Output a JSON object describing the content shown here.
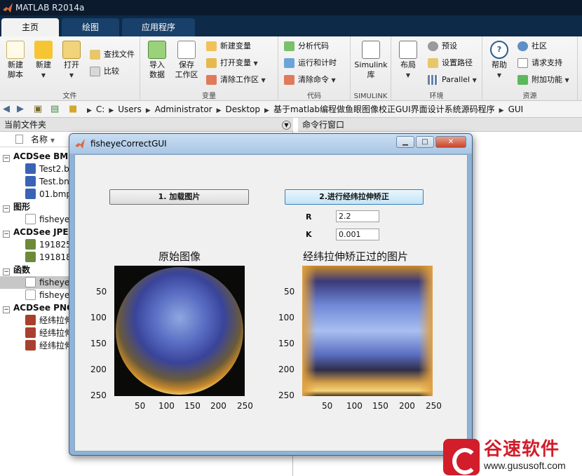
{
  "app": {
    "title": "MATLAB R2014a"
  },
  "tabs": [
    {
      "label": "主页"
    },
    {
      "label": "绘图"
    },
    {
      "label": "应用程序"
    }
  ],
  "ribbon": {
    "file": {
      "group_label": "文件",
      "new_script": "新建\n脚本",
      "new": "新建",
      "open": "打开",
      "find_files": "查找文件",
      "compare": "比较"
    },
    "variable": {
      "group_label": "变量",
      "import_data": "导入\n数据",
      "save_workspace": "保存\n工作区",
      "new_variable": "新建变量",
      "open_variable": "打开变量",
      "clear_workspace": "清除工作区"
    },
    "code": {
      "group_label": "代码",
      "analyze_code": "分析代码",
      "run_and_time": "运行和计时",
      "clear_commands": "清除命令"
    },
    "simulink": {
      "group_label": "SIMULINK",
      "library": "Simulink\n库"
    },
    "environment": {
      "group_label": "环境",
      "layout": "布局",
      "preferences": "预设",
      "set_path": "设置路径",
      "parallel": "Parallel"
    },
    "resources": {
      "group_label": "资源",
      "help": "帮助",
      "community": "社区",
      "request_support": "请求支持",
      "add_ons": "附加功能"
    }
  },
  "address": {
    "crumbs": [
      "C:",
      "Users",
      "Administrator",
      "Desktop",
      "基于matlab编程做鱼眼图像校正GUI界面设计系统源码程序",
      "GUI"
    ]
  },
  "current_folder": {
    "title": "当前文件夹",
    "column_name": "名称",
    "groups": [
      {
        "label": "ACDSee BMP",
        "items": [
          "Test2.b",
          "Test.bn",
          "01.bmp"
        ]
      },
      {
        "label": "图形",
        "items": [
          "fisheye"
        ]
      },
      {
        "label": "ACDSee JPEG",
        "items": [
          "191825",
          "191818"
        ]
      },
      {
        "label": "函数",
        "items": [
          "fisheye",
          "fisheye"
        ]
      },
      {
        "label": "ACDSee PNG",
        "items": [
          "经纬拉伸",
          "经纬拉伸",
          "经纬拉伸"
        ]
      }
    ]
  },
  "command_window": {
    "title": "命令行窗口"
  },
  "gui": {
    "title": "fisheyeCorrectGUI",
    "load_button": "1. 加载图片",
    "correct_button": "2.进行经纬拉伸矫正",
    "r_label": "R",
    "r_value": "2.2",
    "k_label": "K",
    "k_value": "0.001",
    "axes_left_title": "原始图像",
    "axes_right_title": "经纬拉伸矫正过的图片",
    "y_ticks": [
      "50",
      "100",
      "150",
      "200",
      "250"
    ],
    "x_ticks": [
      "50",
      "100",
      "150",
      "200",
      "250"
    ]
  },
  "watermark": {
    "text": "谷速软件",
    "url": "www.gususoft.com"
  },
  "colors": {
    "titlebar": "#0b1a2c",
    "tabstrip": "#0d2a48",
    "accent_red": "#d21d2a"
  }
}
